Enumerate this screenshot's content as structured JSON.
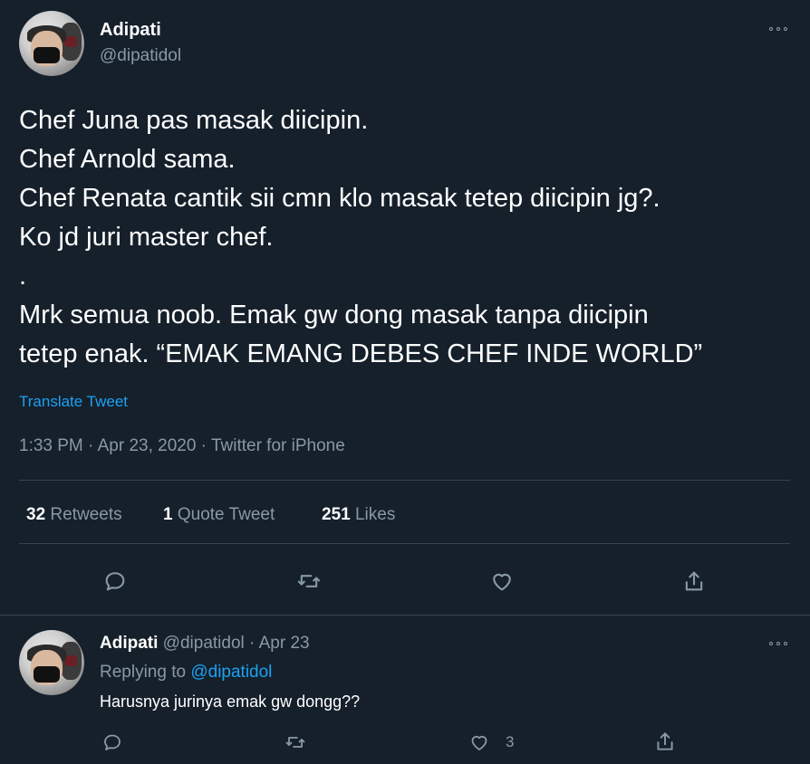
{
  "main_tweet": {
    "display_name": "Adipati",
    "handle": "@dipatidol",
    "lines": [
      "Chef Juna pas masak diicipin.",
      "Chef Arnold sama.",
      "Chef Renata cantik sii cmn klo masak tetep diicipin jg?.",
      "Ko jd juri master chef.",
      ".",
      "Mrk semua noob. Emak gw dong masak tanpa diicipin",
      "tetep enak. “EMAK EMANG DEBES CHEF INDE WORLD”"
    ],
    "translate": "Translate Tweet",
    "timestamp": "1:33 PM · Apr 23, 2020 · Twitter for iPhone",
    "stats": {
      "retweets_count": "32",
      "retweets_label": "Retweets",
      "quotes_count": "1",
      "quotes_label": "Quote Tweet",
      "likes_count": "251",
      "likes_label": "Likes"
    },
    "icons": [
      "reply-icon",
      "retweet-icon",
      "like-icon",
      "share-icon"
    ]
  },
  "reply_tweet": {
    "display_name": "Adipati",
    "handle": "@dipatidol",
    "separator": "·",
    "date": "Apr 23",
    "replying_prefix": "Replying to",
    "replying_handle": "@dipatidol",
    "text": "Harusnya jurinya emak gw dongg??",
    "like_count": "3"
  },
  "colors": {
    "background": "#15202b",
    "text": "#ffffff",
    "muted": "#8899a6",
    "accent": "#1da1f2",
    "divider": "#38444d"
  }
}
